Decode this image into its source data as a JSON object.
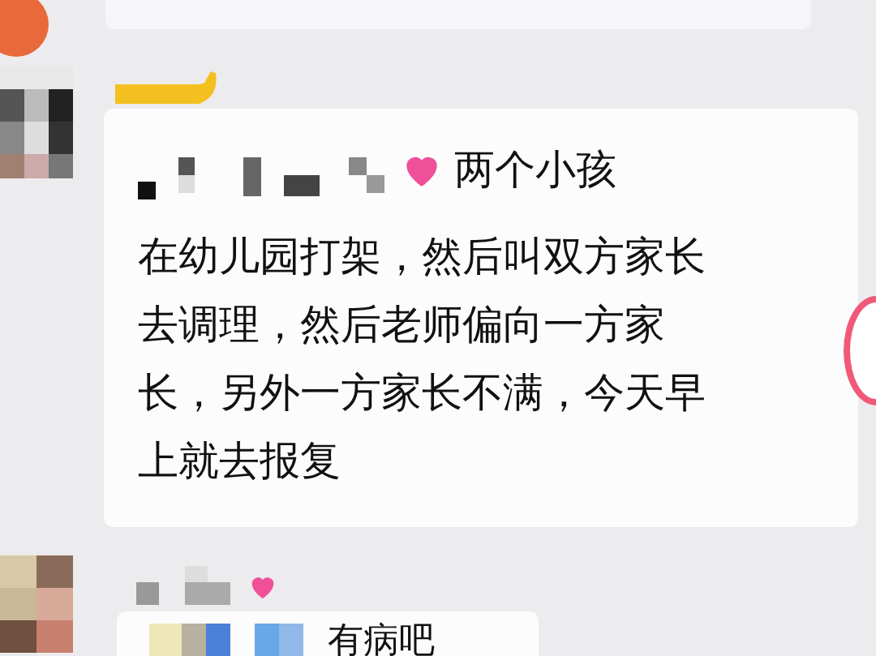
{
  "messages": [
    {
      "kind": "faded"
    },
    {
      "kind": "sticker"
    },
    {
      "kind": "text",
      "lead": "两个小孩",
      "body": "在幼儿园打架，然后叫双方家长去调理，然后老师偏向一方家长，另外一方家长不满，今天早上就去报复"
    },
    {
      "kind": "reply",
      "text": "有病吧"
    }
  ]
}
